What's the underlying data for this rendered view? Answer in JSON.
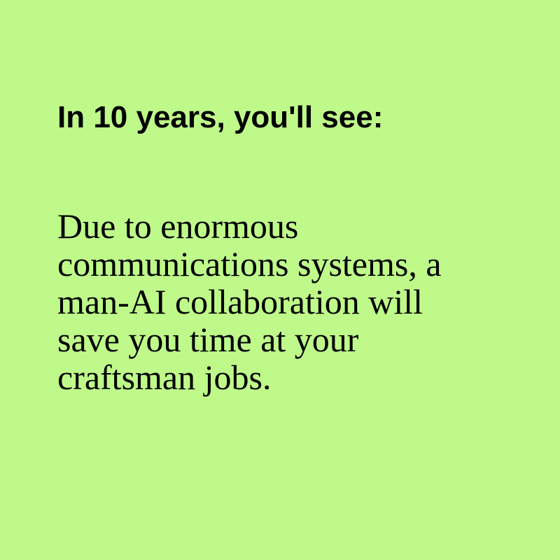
{
  "background_color": "#bef98a",
  "text_color": "#000000",
  "heading": "In 10 years, you'll see:",
  "body_lines": [
    "Due to enormous",
    "communications systems, a",
    "man-AI collaboration will",
    "save you time at your",
    "craftsman jobs."
  ]
}
